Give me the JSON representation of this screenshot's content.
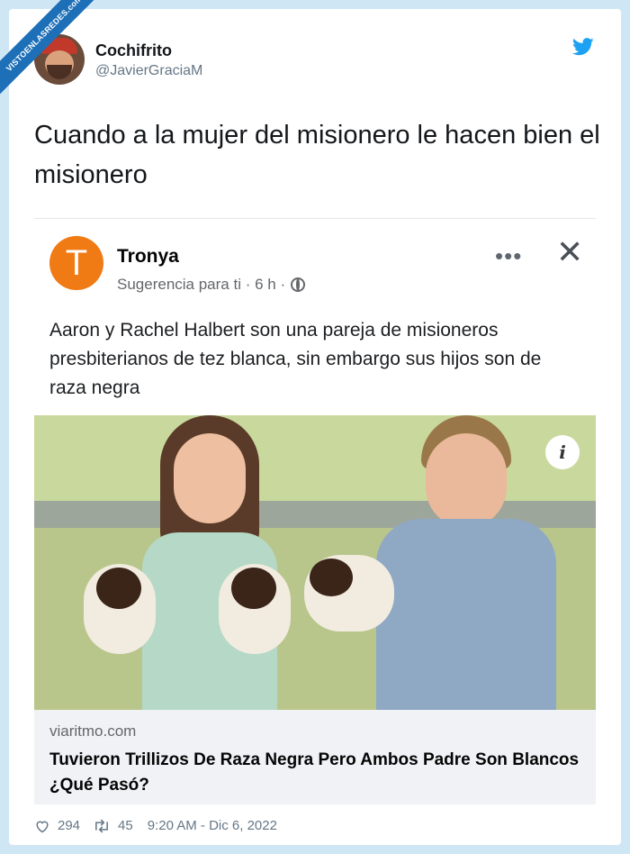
{
  "watermark": "VISTOENLASREDES.com",
  "tweet": {
    "author_name": "Cochifrito",
    "author_handle": "@JavierGraciaM",
    "text": "Cuando a la mujer del misionero le hacen bien el misionero",
    "likes": "294",
    "retweets": "45",
    "timestamp": "9:20 AM - Dic 6, 2022"
  },
  "fb_post": {
    "logo_letter": "T",
    "page_name": "Tronya",
    "meta": "Sugerencia para ti · 6 h ·",
    "more_label": "•••",
    "close_label": "✕",
    "text": "Aaron y Rachel Halbert son una pareja de misioneros presbiterianos de tez blanca, sin embargo sus hijos son de raza negra",
    "info_label": "i",
    "link_domain": "viaritmo.com",
    "link_headline": "Tuvieron Trillizos De Raza Negra Pero Ambos Padre Son Blancos ¿Qué Pasó?"
  },
  "colors": {
    "twitter_blue": "#1da1f2",
    "fb_logo_orange": "#f07a14",
    "background": "#cfe6f5"
  }
}
